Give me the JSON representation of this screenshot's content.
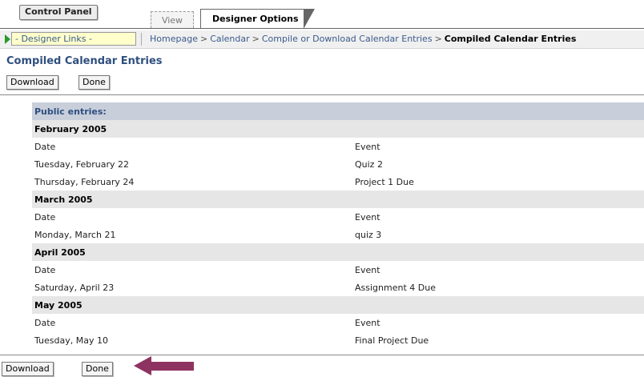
{
  "header": {
    "control_panel": "Control Panel",
    "tabs": [
      {
        "label": "View"
      },
      {
        "label": "Designer Options"
      }
    ]
  },
  "links": {
    "designer_links": "- Designer Links -"
  },
  "breadcrumb": {
    "items": [
      "Homepage",
      "Calendar",
      "Compile or Download Calendar Entries"
    ],
    "current": "Compiled Calendar Entries",
    "separator": ">"
  },
  "page": {
    "title": "Compiled Calendar Entries"
  },
  "toolbar": {
    "download_label": "Download",
    "done_label": "Done"
  },
  "entries": {
    "section_title": "Public entries:",
    "col_date": "Date",
    "col_event": "Event",
    "months": [
      {
        "name": "February 2005",
        "items": [
          {
            "date": "Tuesday, February 22",
            "event": "Quiz 2"
          },
          {
            "date": "Thursday, February 24",
            "event": "Project 1 Due"
          }
        ]
      },
      {
        "name": "March 2005",
        "items": [
          {
            "date": "Monday, March 21",
            "event": "quiz 3"
          }
        ]
      },
      {
        "name": "April 2005",
        "items": [
          {
            "date": "Saturday, April 23",
            "event": "Assignment 4 Due"
          }
        ]
      },
      {
        "name": "May 2005",
        "items": [
          {
            "date": "Tuesday, May 10",
            "event": "Final Project Due"
          }
        ]
      }
    ]
  },
  "colors": {
    "title": "#2f4f7f",
    "link": "#3a5a8c",
    "public_header_bg": "#c8cfdb",
    "month_bg": "#e6e6e6",
    "links_select_bg": "#ffffcc",
    "annotation_arrow": "#8e3361"
  },
  "icons": {
    "links_arrow": "green-play-arrow-icon",
    "annotation": "left-arrow-icon"
  }
}
